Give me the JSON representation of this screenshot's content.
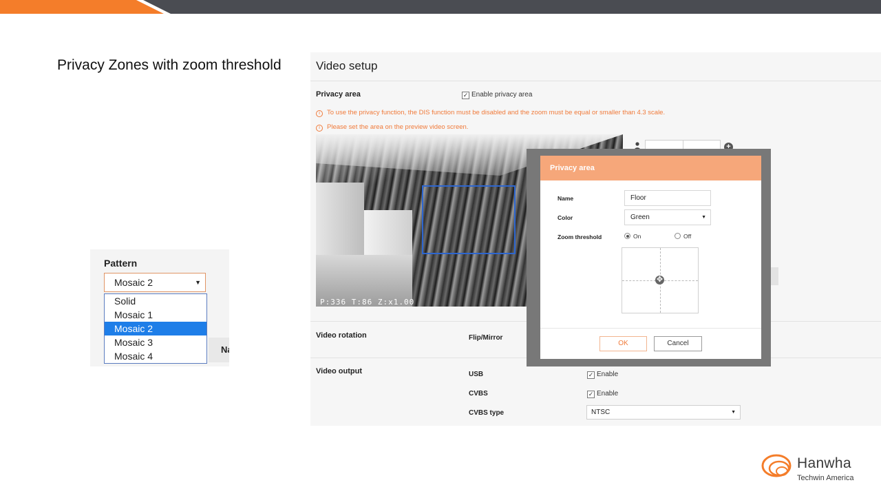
{
  "slide": {
    "title": "Privacy Zones with zoom threshold"
  },
  "pattern": {
    "label": "Pattern",
    "selected": "Mosaic 2",
    "options": [
      "Solid",
      "Mosaic 1",
      "Mosaic 2",
      "Mosaic 3",
      "Mosaic 4"
    ],
    "bg_header": "Na"
  },
  "video_setup": {
    "title": "Video setup",
    "privacy_area": {
      "label": "Privacy area",
      "enable_label": "Enable privacy area",
      "enabled": true,
      "warnings": [
        "To use the privacy function, the DIS function must be disabled and the zoom must be equal or smaller than 4.3 scale.",
        "Please set the area on the preview video screen."
      ],
      "osd_text": "P:336 T:86  Z:x1.00"
    },
    "video_rotation": {
      "label": "Video rotation",
      "flip_mirror_label": "Flip/Mirror"
    },
    "video_output": {
      "label": "Video output",
      "usb_label": "USB",
      "usb_enable_label": "Enable",
      "cvbs_label": "CVBS",
      "cvbs_enable_label": "Enable",
      "cvbs_type_label": "CVBS type",
      "cvbs_type_value": "NTSC"
    }
  },
  "modal": {
    "title": "Privacy area",
    "name_label": "Name",
    "name_value": "Floor",
    "color_label": "Color",
    "color_value": "Green",
    "zoom_threshold_label": "Zoom threshold",
    "on_label": "On",
    "off_label": "Off",
    "zoom_threshold_on": true,
    "ok_label": "OK",
    "cancel_label": "Cancel"
  },
  "brand": {
    "name": "Hanwha",
    "sub": "Techwin America",
    "accent": "#f47d2a"
  }
}
